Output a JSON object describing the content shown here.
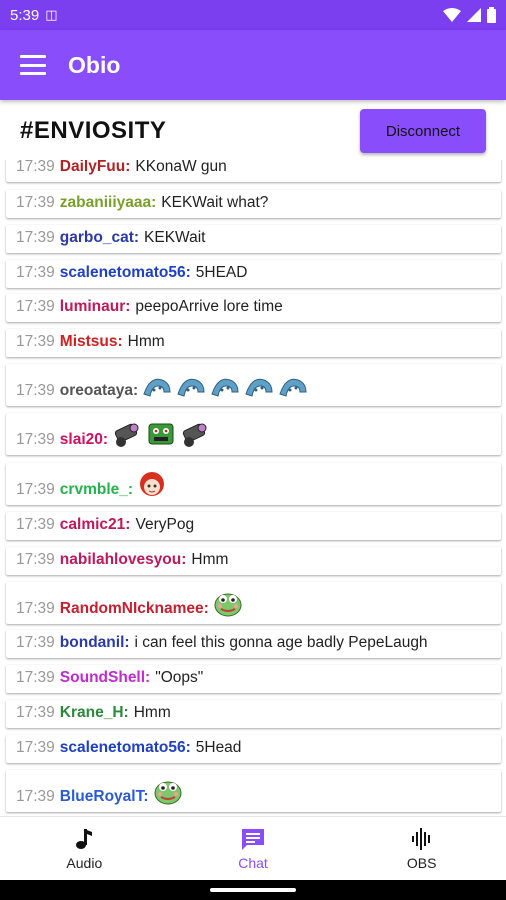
{
  "status": {
    "time": "5:39"
  },
  "app": {
    "title": "Obio"
  },
  "channel": {
    "name": "#ENVIOSITY",
    "disconnect_label": "Disconnect"
  },
  "colors": {
    "accent": "#8a4dfb",
    "status_bar": "#7b3ff0"
  },
  "messages": [
    {
      "time": "17:39",
      "user": "DailyFuu:",
      "text": "KKonaW gun",
      "color": "#b22222"
    },
    {
      "time": "17:39",
      "user": "zabaniiiyaaa:",
      "text": "KEKWait what?",
      "color": "#7aa02c"
    },
    {
      "time": "17:39",
      "user": "garbo_cat:",
      "text": "KEKWait",
      "color": "#2a3aa8"
    },
    {
      "time": "17:39",
      "user": "scalenetomato56:",
      "text": "5HEAD",
      "color": "#1e40c8"
    },
    {
      "time": "17:39",
      "user": "luminaur:",
      "text": "peepoArrive lore time",
      "color": "#c0185a"
    },
    {
      "time": "17:39",
      "user": "Mistsus:",
      "text": "Hmm",
      "color": "#d02020"
    },
    {
      "time": "17:39",
      "user": "oreoataya:",
      "text": "",
      "color": "#555555",
      "emotes": [
        "tentacle-emote",
        "tentacle-emote",
        "tentacle-emote",
        "tentacle-emote",
        "tentacle-emote"
      ]
    },
    {
      "time": "17:39",
      "user": "slai20:",
      "text": "",
      "color": "#d01060",
      "emotes": [
        "cannon-emote",
        "robot-emote",
        "cannon-emote"
      ]
    },
    {
      "time": "17:39",
      "user": "crvmble_:",
      "text": "",
      "color": "#22b34a",
      "emotes": [
        "anime-girl-emote"
      ]
    },
    {
      "time": "17:39",
      "user": "calmic21:",
      "text": "VeryPog",
      "color": "#c0185a"
    },
    {
      "time": "17:39",
      "user": "nabilahlovesyou:",
      "text": "Hmm",
      "color": "#c0185a"
    },
    {
      "time": "17:39",
      "user": "RandomNIcknamee:",
      "text": "",
      "color": "#c81f2f",
      "emotes": [
        "pepe-emote"
      ]
    },
    {
      "time": "17:39",
      "user": "bondanil:",
      "text": "i can feel this gonna age badly PepeLaugh",
      "color": "#2a3aa8"
    },
    {
      "time": "17:39",
      "user": "SoundShell:",
      "text": "\"Oops\"",
      "color": "#c02ad0"
    },
    {
      "time": "17:39",
      "user": "Krane_H:",
      "text": "Hmm",
      "color": "#2a8a3a"
    },
    {
      "time": "17:39",
      "user": "scalenetomato56:",
      "text": "5Head",
      "color": "#1e40c8"
    },
    {
      "time": "17:39",
      "user": "BlueRoyalT:",
      "text": "",
      "color": "#2a5ad8",
      "emotes": [
        "pepe-emote"
      ]
    }
  ],
  "nav": {
    "audio": "Audio",
    "chat": "Chat",
    "obs": "OBS"
  }
}
